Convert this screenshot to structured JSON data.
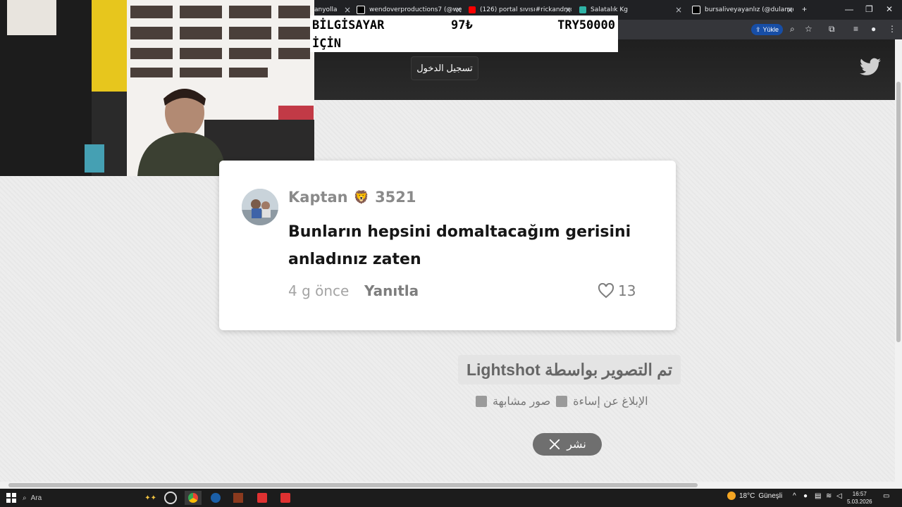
{
  "browser": {
    "tabs": [
      {
        "title": "anyolla",
        "favicon_color": "#5f6368"
      },
      {
        "title": "wendoverproductions7 (@wen",
        "favicon_color": "#000000"
      },
      {
        "title": "(126) portal sıvısı#rickandmorty",
        "favicon_color": "#ff0000"
      },
      {
        "title": "Salatalık Kg",
        "favicon_color": "#2fb3a6"
      },
      {
        "title": "bursaliveyayanlız (@dulanadan",
        "favicon_color": "#000000"
      }
    ],
    "upload_label": "Yükle"
  },
  "banner": {
    "line1": "BİLGİSAYAR",
    "line2": "İÇİN",
    "price": "97₺",
    "goal": "TRY50000"
  },
  "header": {
    "login_label": "تسجيل الدخول"
  },
  "comment": {
    "username": "Kaptan",
    "badge_emoji": "🦁",
    "score": "3521",
    "text": "Bunların hepsini domaltacağım gerisini anladınız zaten",
    "time_ago": "4 g önce",
    "reply_label": "Yanıtla",
    "likes": "13"
  },
  "lightshot": {
    "label": "تم التصوير بواسطة Lightshot",
    "report_label": "الإبلاغ عن إساءة",
    "similar_label": "صور مشابهة",
    "share_label": "نشر"
  },
  "taskbar": {
    "search_placeholder": "Ara",
    "weather": "18°C",
    "weather_desc": "Güneşli",
    "time": "16:57",
    "date": "5.03.2026"
  }
}
